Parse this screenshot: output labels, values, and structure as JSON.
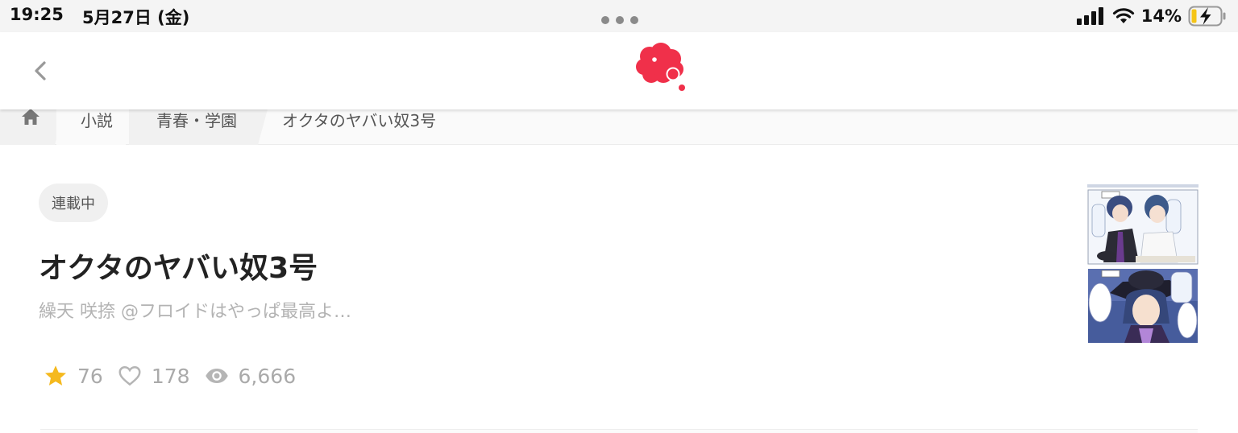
{
  "status_bar": {
    "time": "19:25",
    "date": "5月27日 (金)",
    "battery_percent": "14%",
    "icons": [
      "cellular-signal-icon",
      "wifi-icon",
      "battery-charging-icon"
    ]
  },
  "nav": {
    "back_icon": "chevron-left-icon",
    "logo_icon": "red-cloud-logo",
    "brand_color": "#f0304a"
  },
  "breadcrumb": {
    "home_icon": "home-icon",
    "items": [
      {
        "label": "小説"
      },
      {
        "label": "青春・学園"
      },
      {
        "label": "オクタのヤバい奴3号"
      }
    ]
  },
  "work": {
    "status_badge": "連載中",
    "title": "オクタのヤバい奴3号",
    "author": "繰天 咲捺 @フロイドはやっぱ最高よ…",
    "stats": [
      {
        "icon": "star-icon",
        "value": "76",
        "color": "#f5b91e"
      },
      {
        "icon": "heart-icon",
        "value": "178",
        "color": "#b5b5b5"
      },
      {
        "icon": "eye-icon",
        "value": "6,666",
        "color": "#b5b5b5"
      }
    ],
    "cover_alt": "manga-cover-thumbnail"
  }
}
